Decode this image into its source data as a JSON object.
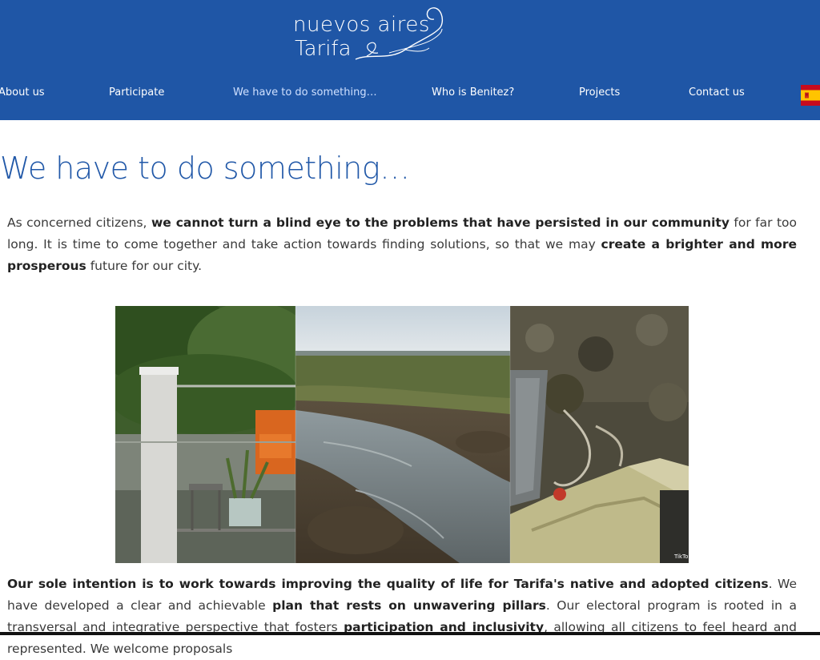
{
  "header": {
    "logo_line1": "nuevos aires",
    "logo_line2": "Tarifa",
    "bg_color": "#1f56a6"
  },
  "nav": {
    "items": [
      {
        "label": "About us"
      },
      {
        "label": "Participate"
      },
      {
        "label": "We have to do something…"
      },
      {
        "label": "Who is Benitez?"
      },
      {
        "label": "Projects"
      },
      {
        "label": "Contact us"
      }
    ],
    "active_index": 2,
    "language_flag": "spain-flag-icon"
  },
  "main": {
    "title": "We have to do something…",
    "intro": {
      "t1": "As concerned citizens, ",
      "b1": "we cannot turn a blind eye to the problems that have persisted in our community",
      "t2": " for far too long. It is time to come together and take action towards finding solutions, so that we may ",
      "b2": "create a brighter and more prosperous",
      "t3": " future for our city."
    },
    "collage": {
      "panels": [
        "garden-with-flooding-photo",
        "muddy-flooded-field-photo",
        "sewage-overflow-photo"
      ],
      "watermark": "TikTok"
    },
    "body": {
      "b1": "Our sole intention is to work towards improving the quality of life for Tarifa's native and adopted citizens",
      "t1": ". We have developed a clear and achievable ",
      "b2": "plan that rests on unwavering pillars",
      "t2": ". Our electoral program is rooted in a transversal and integrative perspective that fosters ",
      "b3": "participation and inclusivity",
      "t3": ", allowing all citizens to feel heard and represented. We welcome proposals"
    }
  }
}
